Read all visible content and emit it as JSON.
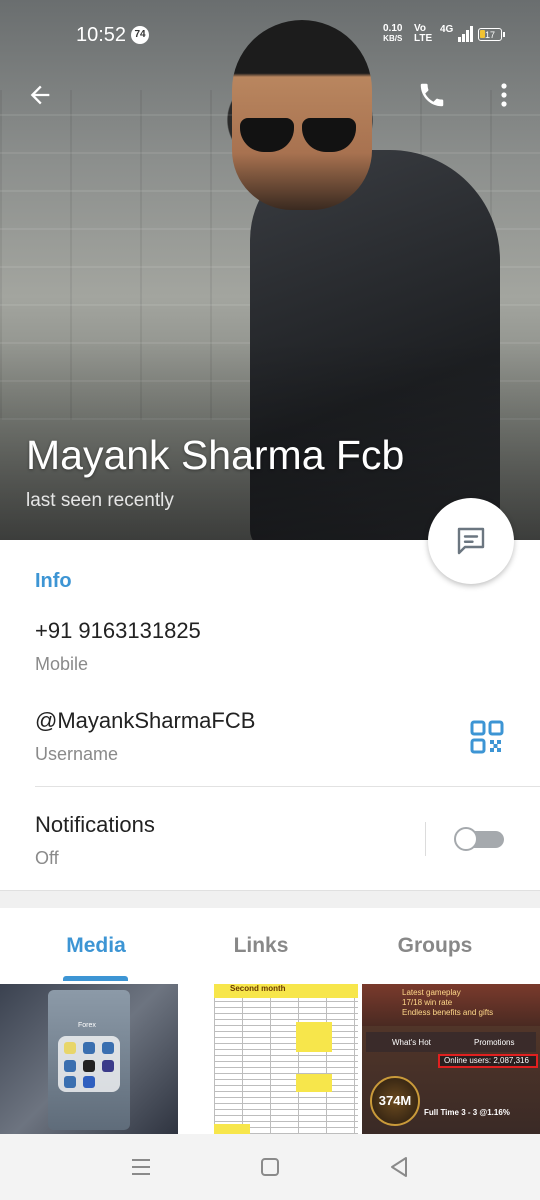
{
  "status_bar": {
    "time": "10:52",
    "notification_badge": "74",
    "net_speed": "0.10",
    "net_unit": "KB/S",
    "volte_top": "Vo",
    "volte_bottom": "LTE",
    "network_type": "4G",
    "battery": "17"
  },
  "profile": {
    "name": "Mayank Sharma Fcb",
    "last_seen": "last seen recently"
  },
  "info": {
    "header": "Info",
    "phone": "+91 9163131825",
    "phone_label": "Mobile",
    "username": "@MayankSharmaFCB",
    "username_label": "Username",
    "notifications_label": "Notifications",
    "notifications_state": "Off"
  },
  "tabs": [
    {
      "label": "Media",
      "active": true
    },
    {
      "label": "Links",
      "active": false
    },
    {
      "label": "Groups",
      "active": false
    }
  ],
  "media": {
    "thumb1": {
      "folder_label": "Forex"
    },
    "thumb2": {
      "sheet_title": "Second month"
    },
    "thumb3": {
      "promo_line1": "Latest gameplay",
      "promo_line2": "17/18 win rate",
      "promo_line3": "Endless benefits and gifts",
      "tab_hot": "What's Hot",
      "tab_promotions": "Promotions",
      "online_users": "Online users: 2,087,316",
      "coin_value": "374M",
      "fulltime": "Full Time 3 - 3 @1.16%"
    }
  },
  "colors": {
    "accent": "#3d95d4",
    "toggle_off": "#a5a9ad"
  }
}
